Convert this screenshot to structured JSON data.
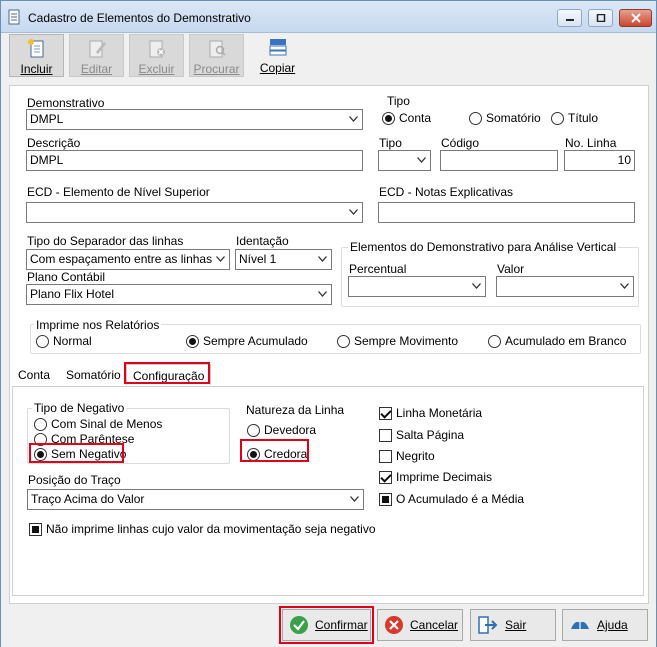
{
  "window": {
    "title": "Cadastro de Elementos do Demonstrativo"
  },
  "toolbar": {
    "incluir": "Incluir",
    "editar": "Editar",
    "excluir": "Excluir",
    "procurar": "Procurar",
    "copiar": "Copiar"
  },
  "form": {
    "demonstrativo_label": "Demonstrativo",
    "demonstrativo_value": "DMPL",
    "tipo_group_label": "Tipo",
    "tipo_options": [
      "Conta",
      "Somatório",
      "Título"
    ],
    "tipo_selected": "Conta",
    "descricao_label": "Descrição",
    "descricao_value": "DMPL",
    "tipo2_label": "Tipo",
    "tipo2_value": "",
    "codigo_label": "Código",
    "codigo_value": "",
    "nolinha_label": "No. Linha",
    "nolinha_value": "10",
    "ecd_sup_label": "ECD - Elemento de Nível Superior",
    "ecd_sup_value": "",
    "ecd_notas_label": "ECD - Notas Explicativas",
    "ecd_notas_value": "",
    "separador_label": "Tipo do Separador das linhas",
    "separador_value": "Com espaçamento entre as linhas",
    "identacao_label": "Identação",
    "identacao_value": "Nível 1",
    "plano_label": "Plano Contábil",
    "plano_value": "Plano Flix Hotel",
    "analise_group_label": "Elementos do Demonstrativo para Análise Vertical",
    "percentual_label": "Percentual",
    "percentual_value": "",
    "valor_label": "Valor",
    "valor_value": ""
  },
  "imprime": {
    "group_label": "Imprime nos Relatórios",
    "options": [
      "Normal",
      "Sempre Acumulado",
      "Sempre Movimento",
      "Acumulado em Branco"
    ],
    "selected": "Sempre Acumulado"
  },
  "tabs": [
    "Conta",
    "Somatório",
    "Configuração"
  ],
  "active_tab": "Configuração",
  "config": {
    "negativo_label": "Tipo de Negativo",
    "negativo_options": [
      "Com Sinal de Menos",
      "Com Parêntese",
      "Sem Negativo"
    ],
    "negativo_selected": "Sem Negativo",
    "natureza_label": "Natureza da Linha",
    "natureza_options": [
      "Devedora",
      "Credora"
    ],
    "natureza_selected": "Credora",
    "checks": [
      {
        "label": "Linha Monetária",
        "checked": true
      },
      {
        "label": "Salta Página",
        "checked": false
      },
      {
        "label": "Negrito",
        "checked": false
      },
      {
        "label": "Imprime Decimais",
        "checked": true
      },
      {
        "label": "O Acumulado é a Média",
        "checked": true
      }
    ],
    "posicao_label": "Posição do Traço",
    "posicao_value": "Traço Acima do Valor",
    "nao_imprime_label": "Não imprime linhas cujo valor da movimentação seja negativo"
  },
  "buttons": {
    "confirmar": "Confirmar",
    "cancelar": "Cancelar",
    "sair": "Sair",
    "ajuda": "Ajuda"
  },
  "colors": {
    "highlight": "#e0001a",
    "confirm_icon": "#3aa04a",
    "cancel_icon": "#d63a2a",
    "sair_icon": "#2f6fb5",
    "ajuda_icon": "#2f6fb5"
  }
}
